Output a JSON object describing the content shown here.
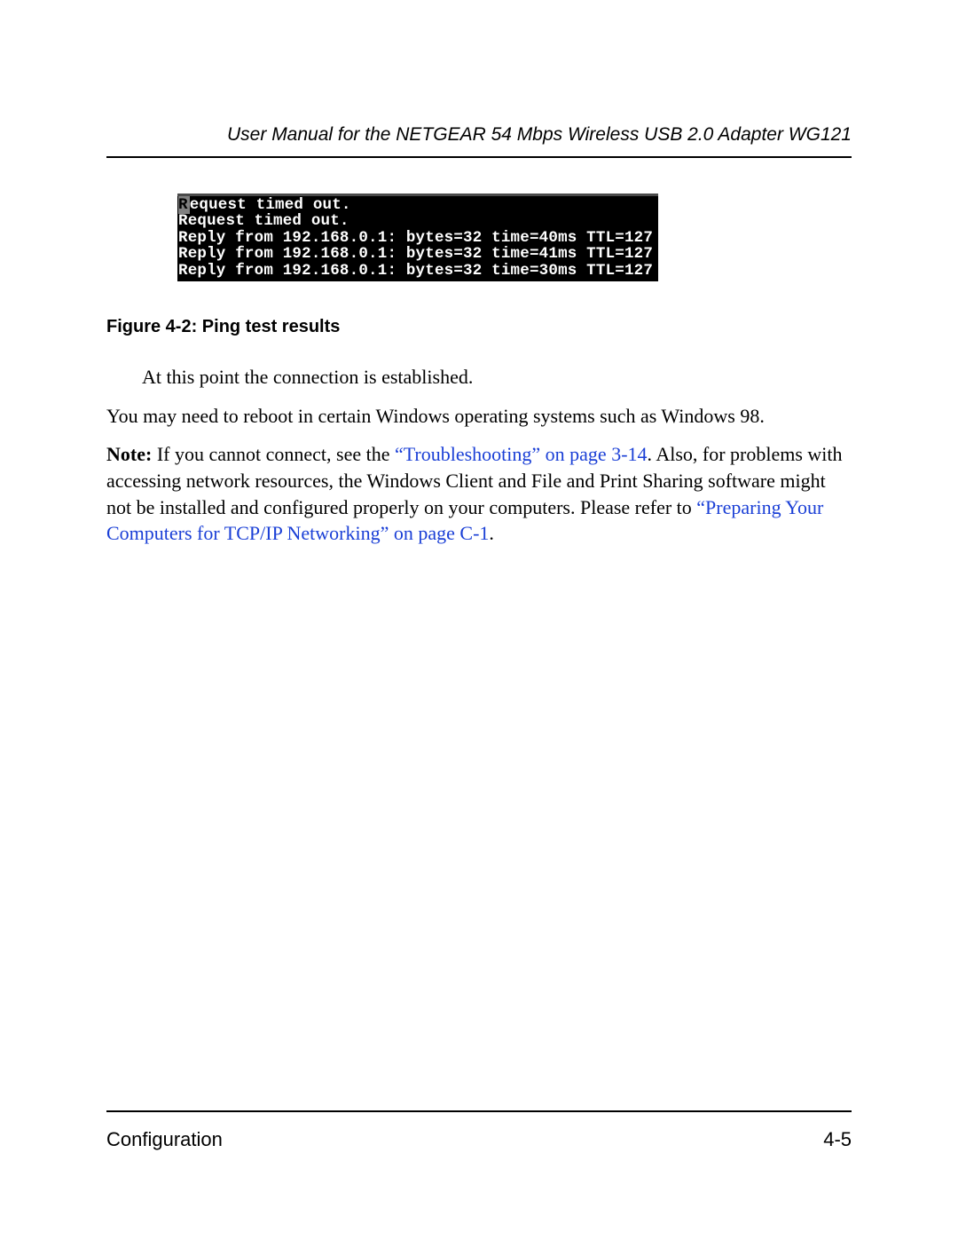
{
  "header": {
    "title": "User Manual for the NETGEAR 54 Mbps Wireless USB 2.0 Adapter WG121"
  },
  "terminal": {
    "first_char": "R",
    "rest_of_line1": "equest timed out.",
    "line2": "Request timed out.",
    "line3": "Reply from 192.168.0.1: bytes=32 time=40ms TTL=127",
    "line4": "Reply from 192.168.0.1: bytes=32 time=41ms TTL=127",
    "line5": "Reply from 192.168.0.1: bytes=32 time=30ms TTL=127"
  },
  "caption": "Figure 4-2:  Ping test results",
  "paragraphs": {
    "p1": "At this point the connection is established.",
    "p2": "You may need to reboot in certain Windows operating systems such as Windows 98.",
    "note_label": "Note:",
    "note_a": " If you cannot connect, see the ",
    "link1": "“Troubleshooting” on page 3-14",
    "note_b": ". Also, for problems with accessing network resources, the Windows Client and File and Print Sharing software might not be installed and configured properly on your computers. Please refer to ",
    "link2": "“Preparing Your Computers for TCP/IP Networking” on page C-1",
    "note_c": "."
  },
  "footer": {
    "left": "Configuration",
    "right": "4-5"
  }
}
